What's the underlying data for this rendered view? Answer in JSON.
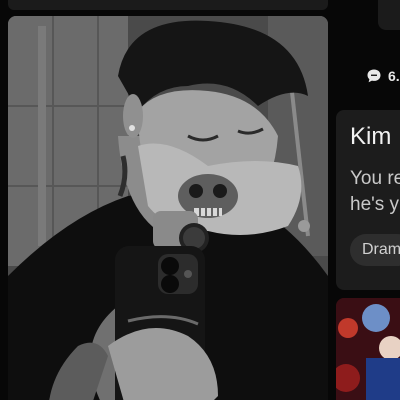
{
  "right_column": {
    "stats": {
      "comment_count": "6."
    },
    "story_card": {
      "title": "Kim",
      "body_line_1": "You re",
      "body_line_2": "he's y",
      "genre_chip": "Dram"
    }
  },
  "icons": {
    "comment": "comment-bubble-icon"
  },
  "colors": {
    "background": "#070707",
    "card_background": "#1c1c1c",
    "chip_background": "#2e2e2e"
  }
}
